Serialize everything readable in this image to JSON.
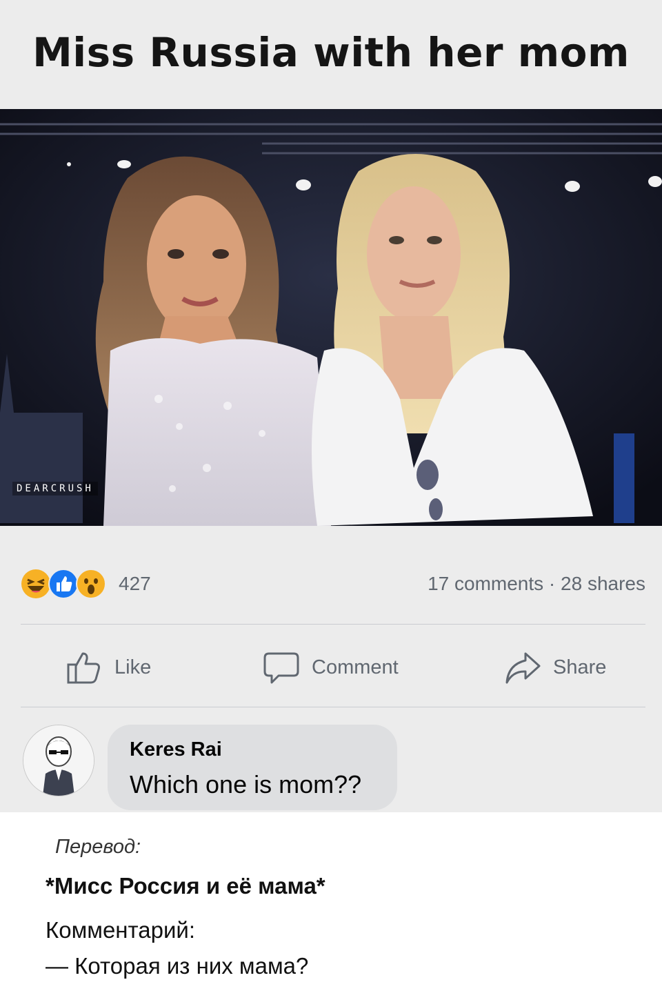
{
  "post": {
    "title": "Miss Russia with her mom",
    "image_alt": "Two women posing on a stage at night",
    "watermark": "DEARCRUSH"
  },
  "reactions": {
    "icons": [
      "laugh-reaction-icon",
      "like-reaction-icon",
      "wow-reaction-icon"
    ],
    "count": "427",
    "comments_shares": "17 comments · 28 shares"
  },
  "actions": {
    "like": "Like",
    "comment": "Comment",
    "share": "Share"
  },
  "comment": {
    "author": "Keres Rai",
    "text": "Which one is mom??"
  },
  "translation": {
    "label": "Перевод:",
    "title": "*Мисс Россия и её мама*",
    "comment_label": "Комментарий:",
    "comment_text": "— Которая из них мама?"
  },
  "colors": {
    "post_bg": "#ececec",
    "secondary_text": "#606770",
    "like_blue": "#1877f2",
    "reaction_yellow": "#f7b125"
  }
}
